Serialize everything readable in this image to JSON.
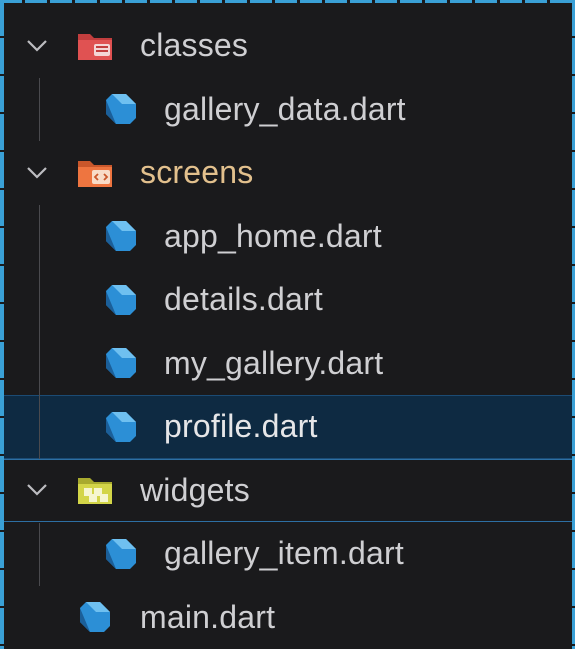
{
  "explorer": {
    "items": [
      {
        "kind": "folder",
        "label": "classes",
        "expanded": true,
        "icon": "folder-classes-icon",
        "color": "#d64a4a",
        "label_color": "#cfcfd2"
      },
      {
        "kind": "file",
        "label": "gallery_data.dart",
        "icon": "dart-icon"
      },
      {
        "kind": "folder",
        "label": "screens",
        "expanded": true,
        "icon": "folder-screens-icon",
        "color": "#e06b3a",
        "label_color": "#e2c08d"
      },
      {
        "kind": "file",
        "label": "app_home.dart",
        "icon": "dart-icon"
      },
      {
        "kind": "file",
        "label": "details.dart",
        "icon": "dart-icon"
      },
      {
        "kind": "file",
        "label": "my_gallery.dart",
        "icon": "dart-icon"
      },
      {
        "kind": "file",
        "label": "profile.dart",
        "icon": "dart-icon",
        "selected": true
      },
      {
        "kind": "folder",
        "label": "widgets",
        "expanded": true,
        "icon": "folder-widgets-icon",
        "color": "#c7c94a",
        "label_color": "#cfcfd2"
      },
      {
        "kind": "file",
        "label": "gallery_item.dart",
        "icon": "dart-icon"
      },
      {
        "kind": "file",
        "label": "main.dart",
        "icon": "dart-icon"
      }
    ]
  },
  "colors": {
    "background": "#1a1a1c",
    "selected_bg": "#0e2a42",
    "dart_blue": "#2c8fd6",
    "text": "#cfcfd2",
    "screens_text": "#e2c08d"
  }
}
